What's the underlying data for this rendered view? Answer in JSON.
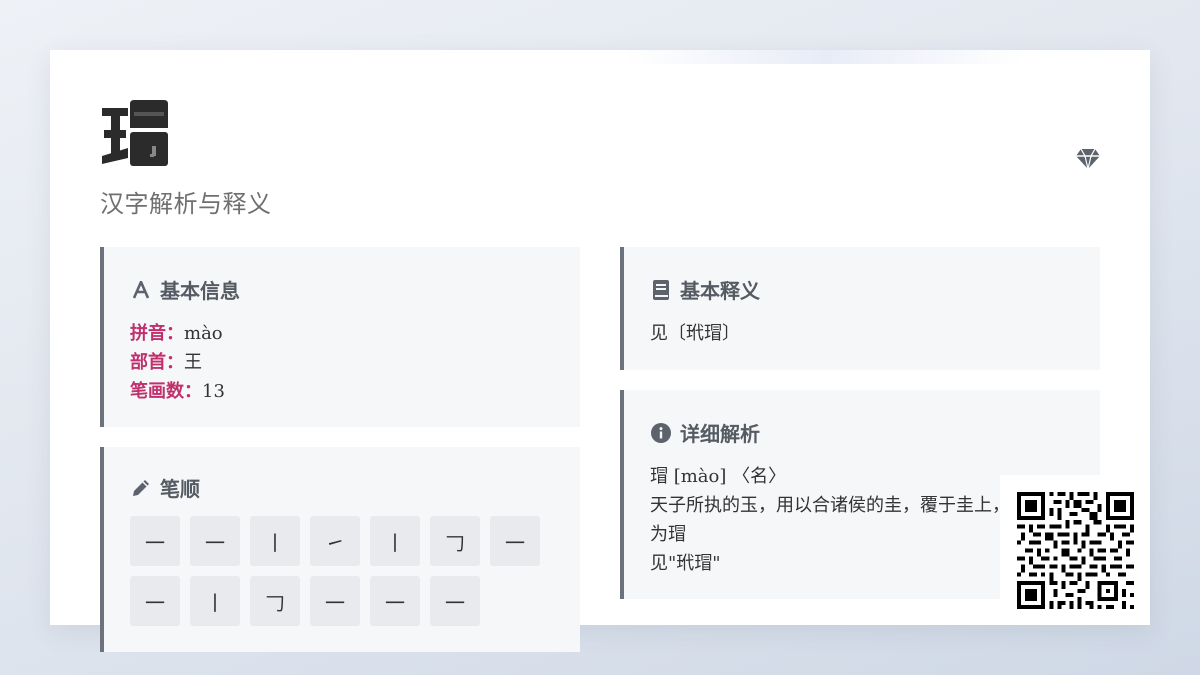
{
  "character": "瑁",
  "subtitle": "汉字解析与释义",
  "basic_info": {
    "title": "基本信息",
    "icon": "font-a-icon",
    "rows": [
      {
        "label": "拼音：",
        "value": "mào"
      },
      {
        "label": "部首：",
        "value": "王"
      },
      {
        "label": "笔画数：",
        "value": "13"
      }
    ]
  },
  "stroke_order": {
    "title": "笔顺",
    "icon": "pencil-icon",
    "strokes": [
      "一",
      "一",
      "丨",
      "㇀",
      "丨",
      "𠃌",
      "一",
      "一",
      "丨",
      "𠃌",
      "一",
      "一",
      "一"
    ]
  },
  "basic_meaning": {
    "title": "基本释义",
    "icon": "book-icon",
    "text": "见〔玳瑁〕"
  },
  "detail": {
    "title": "详细解析",
    "icon": "info-circle-icon",
    "lines": [
      "瑁 [mào] 〈名〉",
      "天子所执的玉，用以合诸侯的圭，覆于圭上，",
      "为瑁",
      "见\"玳瑁\""
    ]
  },
  "colors": {
    "accent_label": "#c0306f",
    "panel_border": "#6c737d",
    "panel_bg": "#f6f7f9"
  }
}
